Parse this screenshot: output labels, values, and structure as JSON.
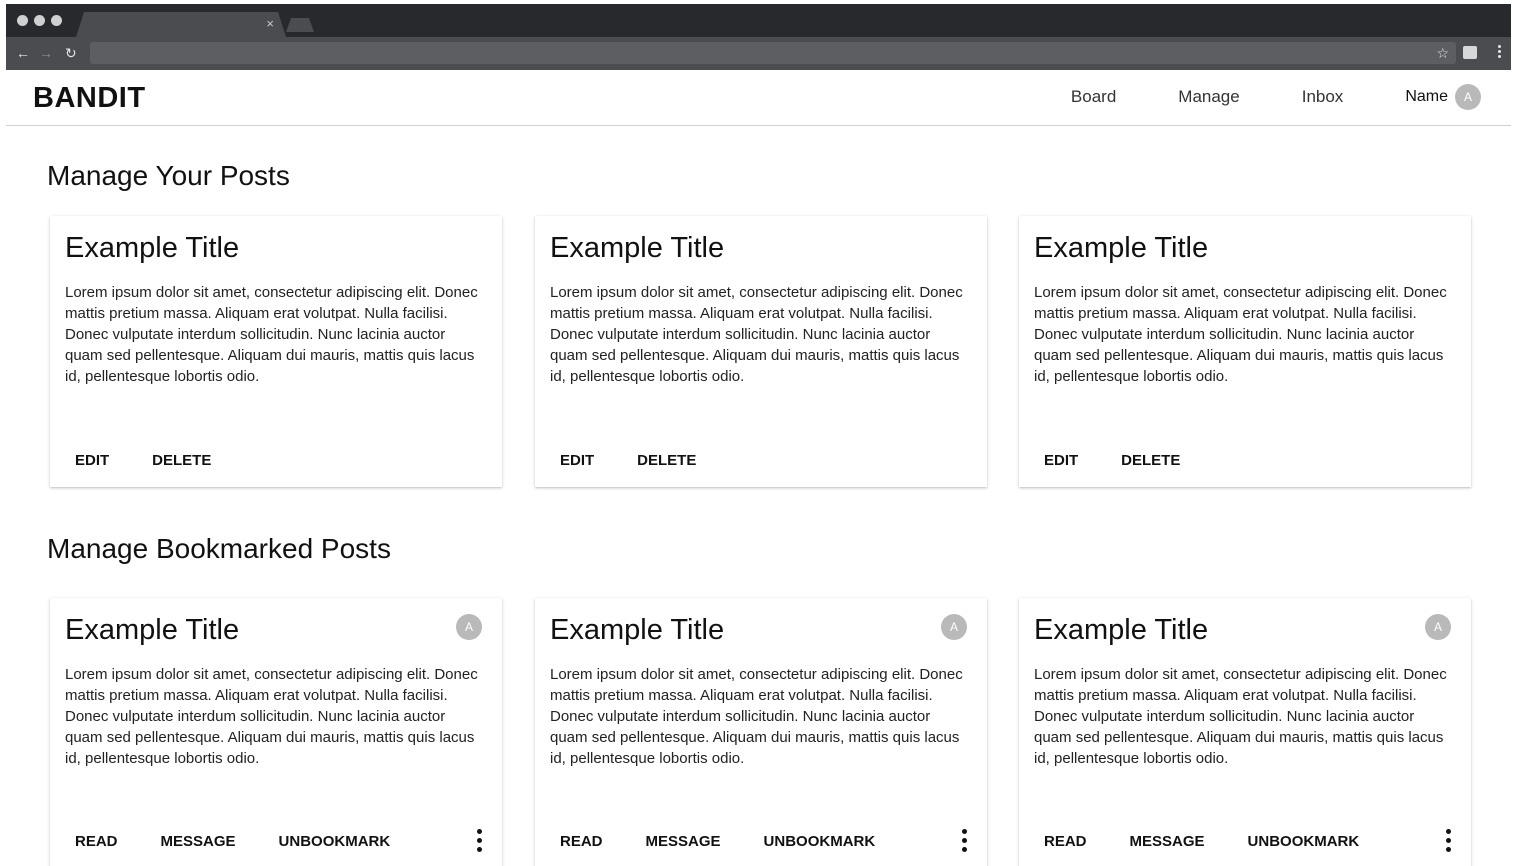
{
  "browser": {
    "tab_close": "×",
    "icons": {
      "back": "arrow-left-icon",
      "forward": "arrow-right-icon",
      "reload": "reload-icon",
      "star": "star-icon",
      "menu": "more-vertical-icon"
    }
  },
  "header": {
    "logo": "BANDIT",
    "nav": [
      {
        "label": "Board"
      },
      {
        "label": "Manage"
      },
      {
        "label": "Inbox"
      }
    ],
    "user": {
      "name": "Name",
      "avatar_initial": "A"
    }
  },
  "your_posts": {
    "title": "Manage Your Posts",
    "cards": [
      {
        "title": "Example Title",
        "body": "Lorem ipsum dolor sit amet, consectetur adipiscing elit. Donec mattis pretium massa. Aliquam erat volutpat. Nulla facilisi. Donec vulputate interdum sollicitudin. Nunc lacinia auctor quam sed pellentesque. Aliquam dui mauris, mattis quis lacus id, pellentesque lobortis odio.",
        "actions": [
          "EDIT",
          "DELETE"
        ]
      },
      {
        "title": "Example Title",
        "body": "Lorem ipsum dolor sit amet, consectetur adipiscing elit. Donec mattis pretium massa. Aliquam erat volutpat. Nulla facilisi. Donec vulputate interdum sollicitudin. Nunc lacinia auctor quam sed pellentesque. Aliquam dui mauris, mattis quis lacus id, pellentesque lobortis odio.",
        "actions": [
          "EDIT",
          "DELETE"
        ]
      },
      {
        "title": "Example Title",
        "body": "Lorem ipsum dolor sit amet, consectetur adipiscing elit. Donec mattis pretium massa. Aliquam erat volutpat. Nulla facilisi. Donec vulputate interdum sollicitudin. Nunc lacinia auctor quam sed pellentesque. Aliquam dui mauris, mattis quis lacus id, pellentesque lobortis odio.",
        "actions": [
          "EDIT",
          "DELETE"
        ]
      }
    ]
  },
  "bookmarked_posts": {
    "title": "Manage Bookmarked Posts",
    "cards": [
      {
        "title": "Example Title",
        "avatar_initial": "A",
        "body": "Lorem ipsum dolor sit amet, consectetur adipiscing elit. Donec mattis pretium massa. Aliquam erat volutpat. Nulla facilisi. Donec vulputate interdum sollicitudin. Nunc lacinia auctor quam sed pellentesque. Aliquam dui mauris, mattis quis lacus id, pellentesque lobortis odio.",
        "actions": [
          "READ",
          "MESSAGE",
          "UNBOOKMARK"
        ]
      },
      {
        "title": "Example Title",
        "avatar_initial": "A",
        "body": "Lorem ipsum dolor sit amet, consectetur adipiscing elit. Donec mattis pretium massa. Aliquam erat volutpat. Nulla facilisi. Donec vulputate interdum sollicitudin. Nunc lacinia auctor quam sed pellentesque. Aliquam dui mauris, mattis quis lacus id, pellentesque lobortis odio.",
        "actions": [
          "READ",
          "MESSAGE",
          "UNBOOKMARK"
        ]
      },
      {
        "title": "Example Title",
        "avatar_initial": "A",
        "body": "Lorem ipsum dolor sit amet, consectetur adipiscing elit. Donec mattis pretium massa. Aliquam erat volutpat. Nulla facilisi. Donec vulputate interdum sollicitudin. Nunc lacinia auctor quam sed pellentesque. Aliquam dui mauris, mattis quis lacus id, pellentesque lobortis odio.",
        "actions": [
          "READ",
          "MESSAGE",
          "UNBOOKMARK"
        ]
      }
    ]
  },
  "colors": {
    "avatar": "#b9b9b9",
    "chrome_dark": "#27292c",
    "chrome_toolbar": "#4a4c50",
    "divider": "#cfcfcf"
  }
}
